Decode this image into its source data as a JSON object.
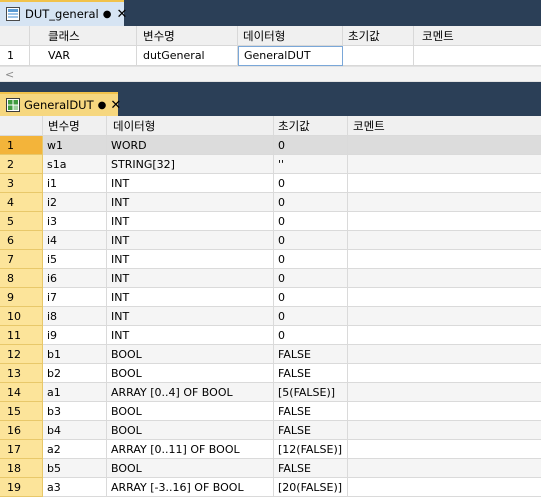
{
  "tab_top": {
    "label": "DUT_general",
    "modified_marker": "●",
    "close_label": "✕"
  },
  "var_table": {
    "columns": [
      "",
      "클래스",
      "변수명",
      "데이터형",
      "초기값",
      "코멘트"
    ],
    "rows": [
      {
        "index": "1",
        "class": "VAR",
        "name": "dutGeneral",
        "type": "GeneralDUT",
        "initial": "",
        "comment": ""
      }
    ]
  },
  "scrollbar": {
    "left_arrow": "<"
  },
  "tab_bottom": {
    "label": "GeneralDUT",
    "modified_marker": "●",
    "close_label": "✕"
  },
  "dut_table": {
    "columns": [
      "",
      "변수명",
      "데이터형",
      "초기값",
      "코멘트"
    ],
    "rows": [
      {
        "index": "1",
        "name": "w1",
        "type": "WORD",
        "initial": "0",
        "comment": ""
      },
      {
        "index": "2",
        "name": "s1a",
        "type": "STRING[32]",
        "initial": "''",
        "comment": ""
      },
      {
        "index": "3",
        "name": "i1",
        "type": "INT",
        "initial": "0",
        "comment": ""
      },
      {
        "index": "4",
        "name": "i2",
        "type": "INT",
        "initial": "0",
        "comment": ""
      },
      {
        "index": "5",
        "name": "i3",
        "type": "INT",
        "initial": "0",
        "comment": ""
      },
      {
        "index": "6",
        "name": "i4",
        "type": "INT",
        "initial": "0",
        "comment": ""
      },
      {
        "index": "7",
        "name": "i5",
        "type": "INT",
        "initial": "0",
        "comment": ""
      },
      {
        "index": "8",
        "name": "i6",
        "type": "INT",
        "initial": "0",
        "comment": ""
      },
      {
        "index": "9",
        "name": "i7",
        "type": "INT",
        "initial": "0",
        "comment": ""
      },
      {
        "index": "10",
        "name": "i8",
        "type": "INT",
        "initial": "0",
        "comment": ""
      },
      {
        "index": "11",
        "name": "i9",
        "type": "INT",
        "initial": "0",
        "comment": ""
      },
      {
        "index": "12",
        "name": "b1",
        "type": "BOOL",
        "initial": "FALSE",
        "comment": ""
      },
      {
        "index": "13",
        "name": "b2",
        "type": "BOOL",
        "initial": "FALSE",
        "comment": ""
      },
      {
        "index": "14",
        "name": "a1",
        "type": "ARRAY [0..4] OF BOOL",
        "initial": "[5(FALSE)]",
        "comment": ""
      },
      {
        "index": "15",
        "name": "b3",
        "type": "BOOL",
        "initial": "FALSE",
        "comment": ""
      },
      {
        "index": "16",
        "name": "b4",
        "type": "BOOL",
        "initial": "FALSE",
        "comment": ""
      },
      {
        "index": "17",
        "name": "a2",
        "type": "ARRAY [0..11] OF BOOL",
        "initial": "[12(FALSE)]",
        "comment": ""
      },
      {
        "index": "18",
        "name": "b5",
        "type": "BOOL",
        "initial": "FALSE",
        "comment": ""
      },
      {
        "index": "19",
        "name": "a3",
        "type": "ARRAY [-3..16] OF BOOL",
        "initial": "[20(FALSE)]",
        "comment": ""
      }
    ],
    "selected_row": 0
  },
  "colors": {
    "title_bar": "#2b3f57",
    "active_tab_top": "#d6e4f3",
    "active_tab_bottom": "#f6d77f",
    "row_index_bg": "#fce49a",
    "selected_index_bg": "#f3b43a",
    "selected_row_bg": "#dcdcdc"
  },
  "icons": {
    "tab_top": "dut-icon",
    "tab_bottom": "struct-icon"
  }
}
